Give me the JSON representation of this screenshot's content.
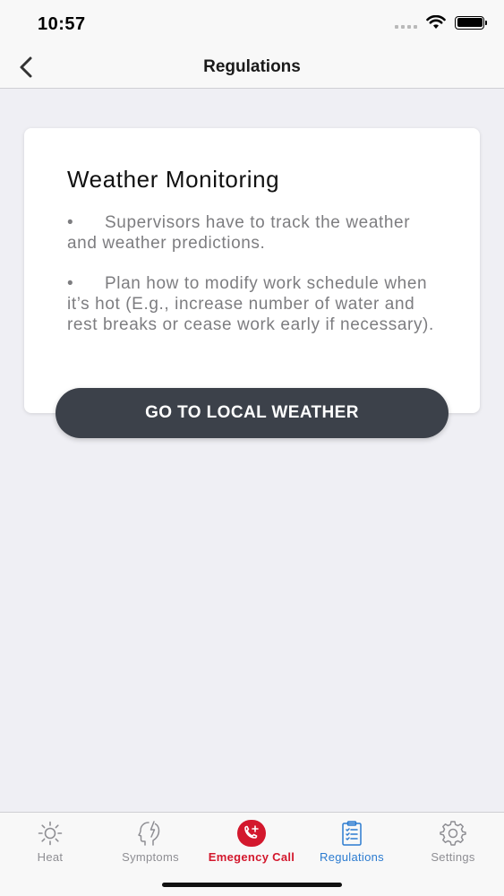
{
  "status_bar": {
    "time": "10:57",
    "icons": [
      "cellular-signal-icon",
      "wifi-icon",
      "battery-icon"
    ]
  },
  "nav": {
    "title": "Regulations",
    "back_icon": "chevron-left-icon"
  },
  "card": {
    "title": "Weather Monitoring",
    "bullets": [
      {
        "marker": "•",
        "text": "Supervisors have to track the weather and weather predictions."
      },
      {
        "marker": "•",
        "text": "Plan how to modify work schedule when it’s hot (E.g., increase number of water and rest breaks or cease work early if necessary)."
      }
    ]
  },
  "cta": {
    "label": "GO TO LOCAL WEATHER"
  },
  "tabs": [
    {
      "label": "Heat",
      "icon": "sun-icon",
      "state": "inactive"
    },
    {
      "label": "Symptoms",
      "icon": "head-bolt-icon",
      "state": "inactive"
    },
    {
      "label": "Emegency Call",
      "icon": "phone-plus-icon",
      "state": "emergency"
    },
    {
      "label": "Regulations",
      "icon": "clipboard-list-icon",
      "state": "active"
    },
    {
      "label": "Settings",
      "icon": "gear-icon",
      "state": "inactive"
    }
  ],
  "colors": {
    "background": "#efeff4",
    "card": "#ffffff",
    "button": "#3c414a",
    "active_tab": "#2b7bd0",
    "emergency": "#d3182d",
    "inactive_tab": "#8e8e93"
  }
}
